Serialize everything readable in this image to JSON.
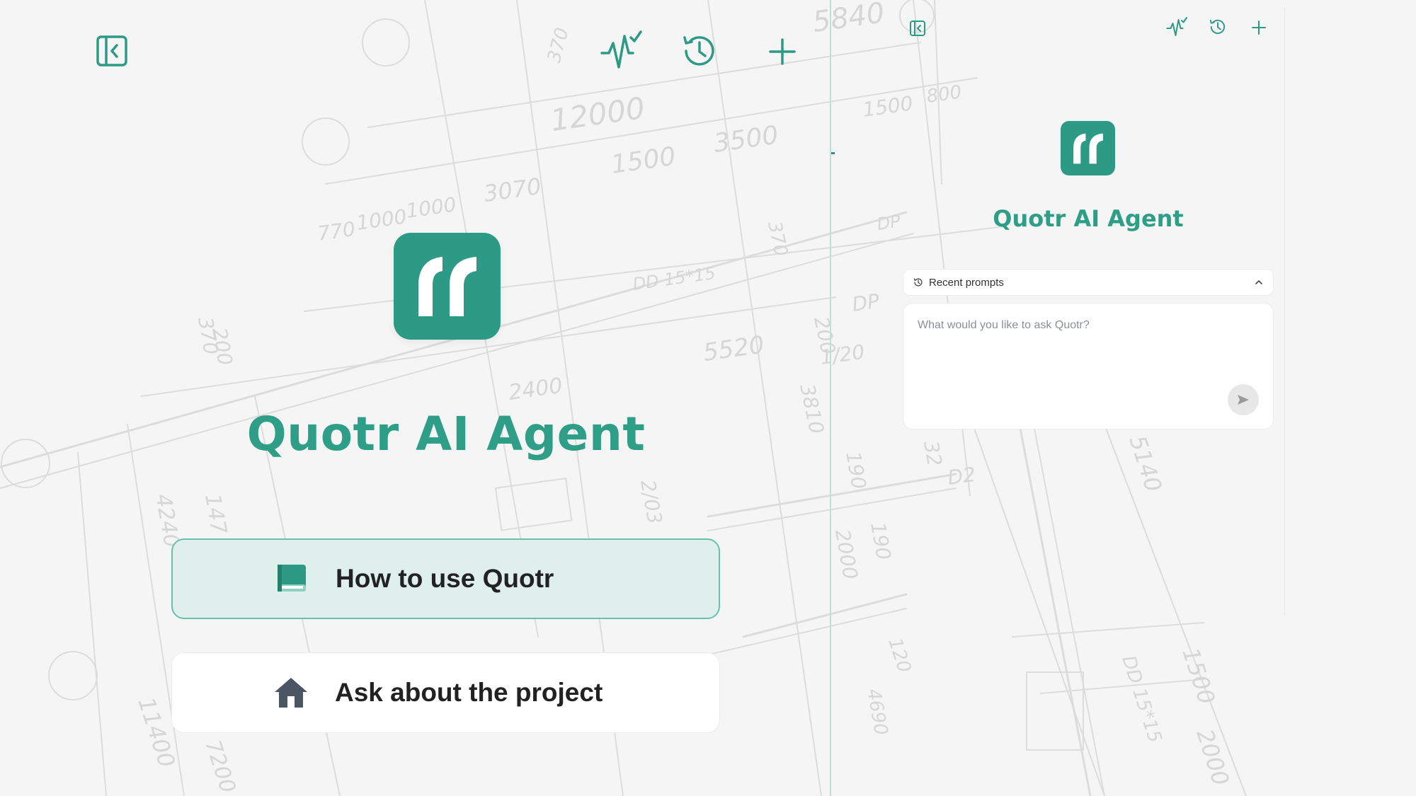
{
  "colors": {
    "brand": "#2c9a84",
    "brand_text": "#2f9e86",
    "card_active_bg": "#dff0ec",
    "card_active_border": "#66c2ac"
  },
  "main": {
    "toolbar": {
      "collapse_icon": "sidebar-collapse-icon",
      "activity_icon": "activity-check-icon",
      "history_icon": "history-icon",
      "new_icon": "plus-icon"
    },
    "title": "Quotr AI Agent",
    "cards": [
      {
        "label": "How to use Quotr",
        "icon": "book-icon"
      },
      {
        "label": "Ask about the project",
        "icon": "home-icon"
      }
    ]
  },
  "panel": {
    "title": "Quotr AI Agent",
    "recent_prompts_label": "Recent prompts",
    "prompt_placeholder": "What would you like to ask Quotr?",
    "send_icon": "send-icon"
  },
  "blueprint_dims": [
    "5840",
    "370",
    "12000",
    "3500",
    "1500",
    "1500",
    "800",
    "3070",
    "770",
    "1000",
    "1000",
    "DP",
    "370",
    "DD 15*15",
    "DP",
    "5520",
    "1/20",
    "3810",
    "200",
    "2400",
    "370",
    "200",
    "4240",
    "147",
    "2/03",
    "190",
    "2000",
    "190",
    "32",
    "D2",
    "5140",
    "120",
    "4690",
    "DD 15*15",
    "1500",
    "2000",
    "11400",
    "7200"
  ]
}
